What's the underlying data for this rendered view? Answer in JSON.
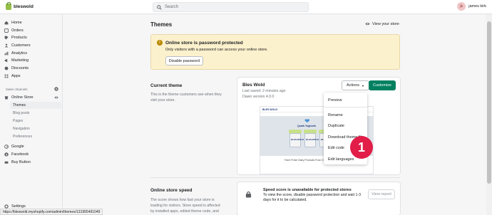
{
  "app": {
    "store_name": "bleswold"
  },
  "search": {
    "placeholder": "Search"
  },
  "user": {
    "initials": "jk",
    "name": "james kirk"
  },
  "sidebar": {
    "items": [
      {
        "label": "Home",
        "icon": "home-icon"
      },
      {
        "label": "Orders",
        "icon": "orders-icon"
      },
      {
        "label": "Products",
        "icon": "products-icon"
      },
      {
        "label": "Customers",
        "icon": "customers-icon"
      },
      {
        "label": "Analytics",
        "icon": "analytics-icon"
      },
      {
        "label": "Marketing",
        "icon": "marketing-icon"
      },
      {
        "label": "Discounts",
        "icon": "discounts-icon"
      },
      {
        "label": "Apps",
        "icon": "apps-icon"
      }
    ],
    "sales_channels_label": "Sales channels",
    "online_store_label": "Online Store",
    "sub_items": [
      "Themes",
      "Blog posts",
      "Pages",
      "Navigation",
      "Preferences"
    ],
    "channels": [
      {
        "label": "Google",
        "icon": "google-icon"
      },
      {
        "label": "Facebook",
        "icon": "facebook-icon"
      },
      {
        "label": "Buy Button",
        "icon": "buy-button-icon"
      }
    ],
    "settings_label": "Settings"
  },
  "page": {
    "title": "Themes",
    "view_store": "View your store"
  },
  "banner": {
    "title": "Online store is password protected",
    "text": "Only visitors with a password can access your online store.",
    "button": "Disable password"
  },
  "current_theme": {
    "section_title": "Current theme",
    "section_desc": "This is the theme customers see when they visit your store.",
    "name": "Bles Wold",
    "last_saved": "Last saved: 2 minutes ago",
    "version": "Dawn version 4.0.0",
    "actions_label": "Actions",
    "customize_label": "Customize"
  },
  "preview": {
    "logo": "BLES WOLD",
    "headline": "Quark Yoghurts",
    "tub_label": "BLES•WOLD",
    "caption_left": "Farm Fresh Dairy Products From Our Farm to Yours!",
    "caption_right": "y products from Our"
  },
  "actions_menu": {
    "items": [
      "Preview",
      "Rename",
      "Duplicate",
      "Download theme file",
      "Edit code",
      "Edit languages"
    ]
  },
  "step_badge": "1",
  "speed": {
    "section_title": "Online store speed",
    "section_desc": "The score shows how fast your store is loading for visitors. Store speed is affected by installed apps, edited theme code, and the",
    "title": "Speed score is unavailable for protected stores",
    "text": "To view the score, disable password protection and wait 1-3 days for it to be calculated.",
    "button": "View report"
  },
  "status_url": "https://bleswold.myshopify.com/admin/themes/131955491049"
}
